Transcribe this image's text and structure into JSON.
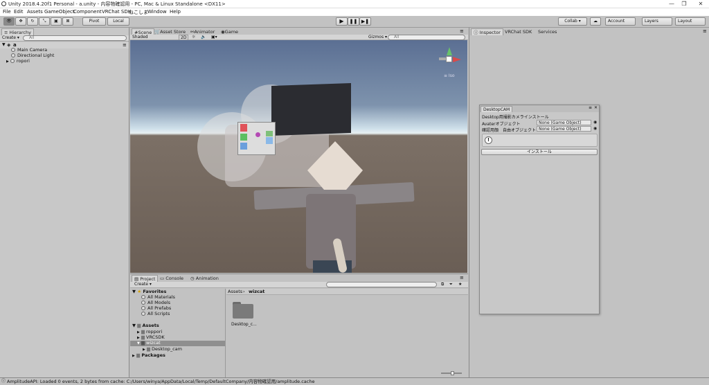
{
  "titlebar": {
    "title": "Unity 2018.4.20f1 Personal - a.unity - 内容物確認用 - PC, Mac & Linux Standalone <DX11>",
    "min": "—",
    "max": "❐",
    "close": "✕"
  },
  "menu": [
    "File",
    "Edit",
    "Assets",
    "GameObject",
    "Component",
    "VRChat SDK",
    "ねこしま",
    "Window",
    "Help"
  ],
  "toolbar": {
    "pivot": "Pivot",
    "local": "Local",
    "collab": "Collab ▾",
    "cloud": "☁",
    "account": "Account",
    "layers": "Layers",
    "layout": "Layout"
  },
  "hierarchy": {
    "tab": "Hierarchy",
    "create": "Create ▾",
    "search_placeholder": "All",
    "scene": "a",
    "items": [
      "Main Camera",
      "Directional Light",
      "ropori"
    ]
  },
  "scene_tabs": [
    "Scene",
    "Asset Store",
    "Animator",
    "Game"
  ],
  "scene_toolbar": {
    "shaded": "Shaded",
    "mode2d": "2D",
    "gizmos": "Gizmos ▾",
    "search_placeholder": "All"
  },
  "gizmo": {
    "label": "≡ Iso"
  },
  "project": {
    "tabs": [
      "Project",
      "Console",
      "Animation"
    ],
    "create": "Create ▾",
    "favorites_label": "Favorites",
    "favorites": [
      "All Materials",
      "All Models",
      "All Prefabs",
      "All Scripts"
    ],
    "assets_label": "Assets",
    "assets": [
      "roppori",
      "VRCSDK",
      "wizcat"
    ],
    "wizcat_child": "Desktop_cam",
    "packages_label": "Packages",
    "breadcrumb": [
      "Assets",
      "wizcat"
    ],
    "folder_name": "Desktop_c..."
  },
  "inspector_tabs": [
    "Inspector",
    "VRChat SDK",
    "Services"
  ],
  "popup": {
    "tab": "DesktopCAM",
    "header": "Desktop用撮影カメラインストール",
    "rows": [
      {
        "label": "Avaterオブジェクト",
        "value": "None (Game Object)"
      },
      {
        "label": "確認用顔　自由オブジェクト",
        "value": "None (Game Object)"
      }
    ],
    "install_button": "インストール"
  },
  "status": "AmplitudeAPI: Loaded 0 events, 2 bytes from cache: C:/Users/winya/AppData/Local/Temp/DefaultCompany/内容物確認用/amplitude.cache",
  "colors": {
    "selection": "#3e7de0",
    "folder": "#7a7a7a",
    "panel": "#c2c2c2"
  }
}
